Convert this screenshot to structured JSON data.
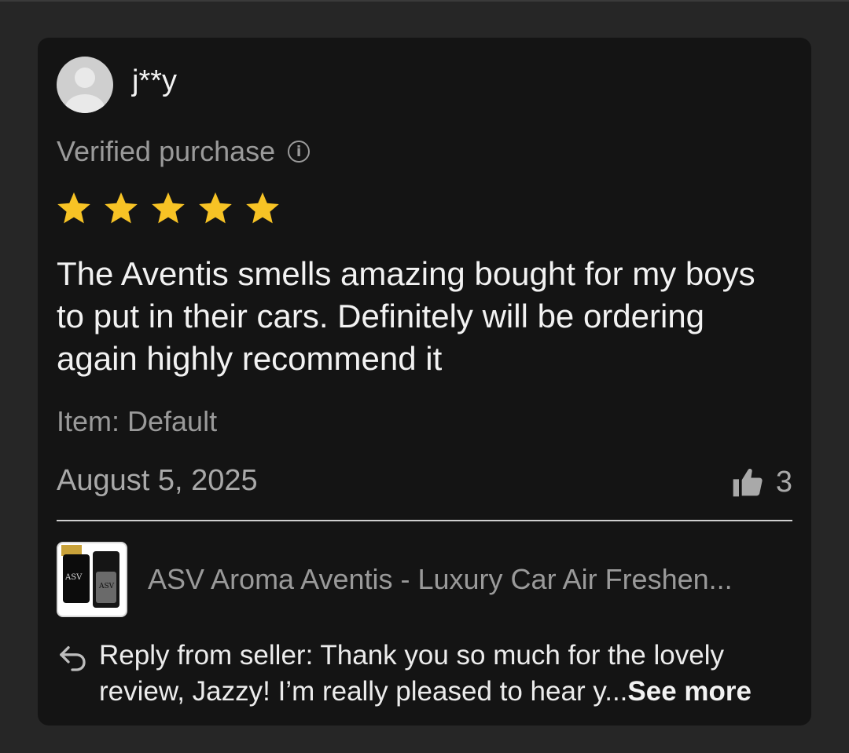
{
  "review": {
    "username": "j**y",
    "verified_label": "Verified purchase",
    "rating": 5,
    "rating_max": 5,
    "star_color": "#f7c325",
    "text": "The Aventis smells amazing bought for my boys to put in their cars. Definitely will be ordering again highly recommend it",
    "item_label": "Item: Default",
    "date": "August 5, 2025",
    "helpful_count": "3"
  },
  "product": {
    "title": "ASV Aroma Aventis - Luxury Car Air Freshen...",
    "thumb_brand_1": "ASV",
    "thumb_brand_2": "ASV"
  },
  "seller_reply": {
    "text": "Reply from seller: Thank you so much for the lovely review, Jazzy! I’m really pleased to hear y...",
    "see_more_label": "See more"
  },
  "icons": {
    "avatar": "default-avatar-icon",
    "info": "info-icon",
    "star": "star-icon",
    "helpful": "thumbs-up-icon",
    "reply": "reply-arrow-icon"
  }
}
